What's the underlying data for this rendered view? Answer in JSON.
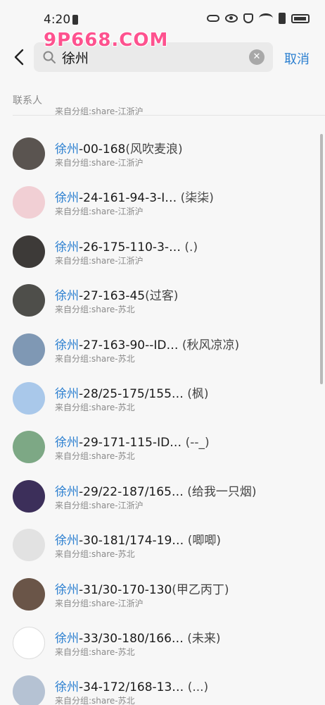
{
  "status_bar": {
    "time": "4:20"
  },
  "watermark": "9P668.COM",
  "search": {
    "query": "徐州",
    "cancel_label": "取消"
  },
  "section_label": "联系人",
  "partial_item_sub": "来自分组:share-江浙沪",
  "contacts": [
    {
      "highlight": "徐州",
      "rest": "-00-168",
      "nickname": "(风吹麦浪)",
      "group": "来自分组:share-江浙沪",
      "avatar_color": "#5a5450"
    },
    {
      "highlight": "徐州",
      "rest": "-24-161-94-3-I…",
      "nickname": " (柒柒)",
      "group": "来自分组:share-江浙沪",
      "avatar_color": "#f1cfd4"
    },
    {
      "highlight": "徐州",
      "rest": "-26-175-110-3-…",
      "nickname": " (.)",
      "group": "来自分组:share-江浙沪",
      "avatar_color": "#3d3a38"
    },
    {
      "highlight": "徐州",
      "rest": "-27-163-45",
      "nickname": "(过客)",
      "group": "来自分组:share-苏北",
      "avatar_color": "#4e4e4a"
    },
    {
      "highlight": "徐州",
      "rest": "-27-163-90--ID…",
      "nickname": " (秋风凉凉)",
      "group": "来自分组:share-苏北",
      "avatar_color": "#7f98b4"
    },
    {
      "highlight": "徐州",
      "rest": "-28/25-175/155…",
      "nickname": " (枫)",
      "group": "来自分组:share-苏北",
      "avatar_color": "#a9c8ea"
    },
    {
      "highlight": "徐州",
      "rest": "-29-171-115-ID…",
      "nickname": " (--_)",
      "group": "来自分组:share-苏北",
      "avatar_color": "#7da885"
    },
    {
      "highlight": "徐州",
      "rest": "-29/22-187/165…",
      "nickname": " (给我一只烟)",
      "group": "来自分组:share-江浙沪",
      "avatar_color": "#3c2f5a"
    },
    {
      "highlight": "徐州",
      "rest": "-30-181/174-19…",
      "nickname": " (唧唧)",
      "group": "来自分组:share-苏北",
      "avatar_color": "#e2e2e2"
    },
    {
      "highlight": "徐州",
      "rest": "-31/30-170-130",
      "nickname": "(甲乙丙丁)",
      "group": "来自分组:share-江浙沪",
      "avatar_color": "#6a5548"
    },
    {
      "highlight": "徐州",
      "rest": "-33/30-180/166…",
      "nickname": " (未来)",
      "group": "来自分组:share-苏北",
      "avatar_color": "#ffffff"
    },
    {
      "highlight": "徐州",
      "rest": "-34-172/168-13…",
      "nickname": " (...)",
      "group": "来自分组:share-苏北",
      "avatar_color": "#b5c2d3"
    }
  ]
}
